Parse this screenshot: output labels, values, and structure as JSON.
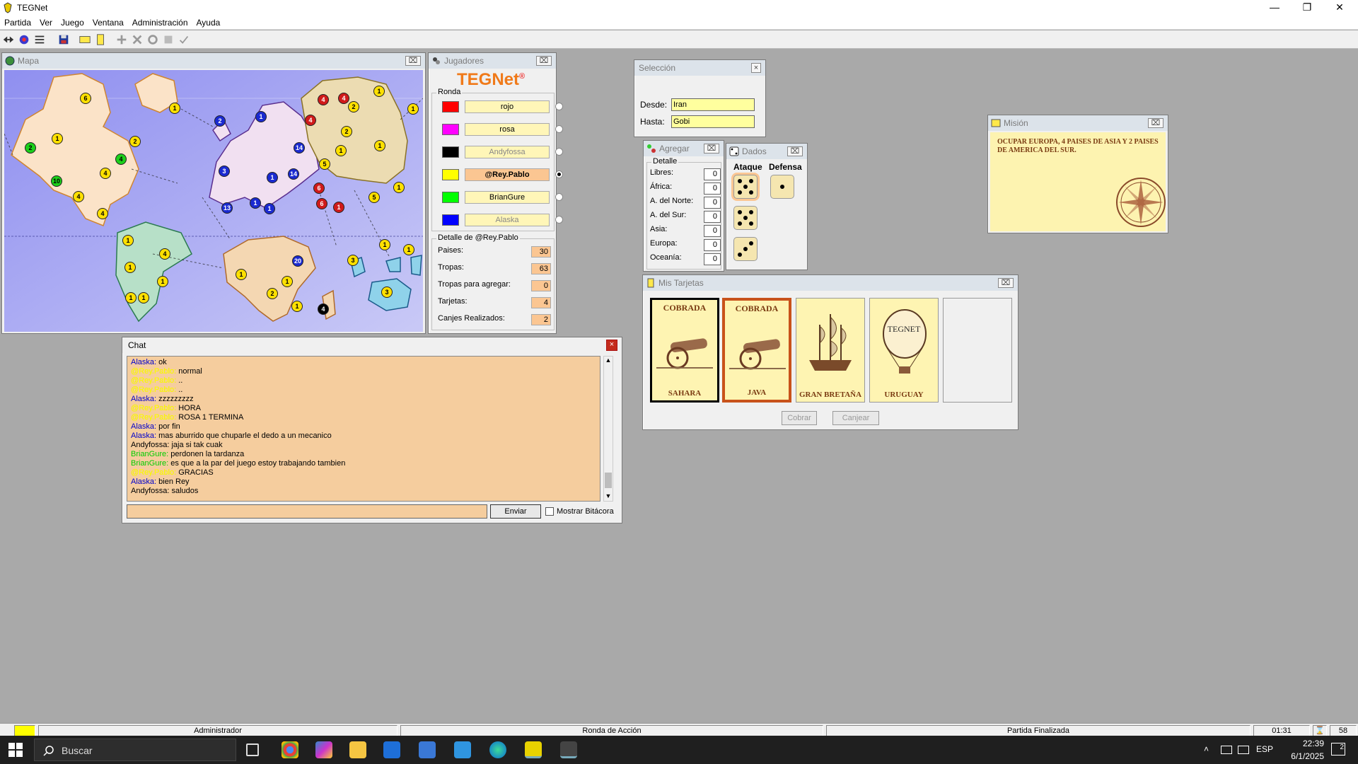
{
  "app": {
    "title": "TEGNet"
  },
  "menu": [
    "Partida",
    "Ver",
    "Juego",
    "Ventana",
    "Administración",
    "Ayuda"
  ],
  "toolbar": {
    "icons": [
      "connect-icon",
      "player-icon",
      "list-icon",
      "save-icon",
      "card-icon",
      "mission-icon",
      "attack-icon",
      "cancel-icon",
      "move-icon",
      "regroup-icon",
      "check-icon"
    ]
  },
  "map_window": {
    "title": "Mapa",
    "armies": [
      {
        "c": "yellow",
        "n": "6"
      },
      {
        "c": "yellow",
        "n": "1"
      },
      {
        "c": "green",
        "n": "2"
      },
      {
        "c": "yellow",
        "n": "1"
      },
      {
        "c": "yellow",
        "n": "2"
      },
      {
        "c": "green",
        "n": "4"
      },
      {
        "c": "green",
        "n": "10"
      },
      {
        "c": "yellow",
        "n": "4"
      },
      {
        "c": "yellow",
        "n": "4"
      },
      {
        "c": "yellow",
        "n": "4"
      },
      {
        "c": "blue",
        "n": "2"
      },
      {
        "c": "blue",
        "n": "1"
      },
      {
        "c": "blue",
        "n": "14"
      },
      {
        "c": "blue",
        "n": "3"
      },
      {
        "c": "blue",
        "n": "1"
      },
      {
        "c": "blue",
        "n": "1"
      },
      {
        "c": "blue",
        "n": "14"
      },
      {
        "c": "blue",
        "n": "13"
      },
      {
        "c": "blue",
        "n": "1"
      },
      {
        "c": "red",
        "n": "4"
      },
      {
        "c": "red",
        "n": "4"
      },
      {
        "c": "red",
        "n": "4"
      },
      {
        "c": "red",
        "n": "6"
      },
      {
        "c": "red",
        "n": "6"
      },
      {
        "c": "red",
        "n": "1"
      },
      {
        "c": "yellow",
        "n": "1"
      },
      {
        "c": "yellow",
        "n": "1"
      },
      {
        "c": "yellow",
        "n": "2"
      },
      {
        "c": "yellow",
        "n": "2"
      },
      {
        "c": "yellow",
        "n": "1"
      },
      {
        "c": "yellow",
        "n": "5"
      },
      {
        "c": "yellow",
        "n": "1"
      },
      {
        "c": "yellow",
        "n": "5"
      },
      {
        "c": "yellow",
        "n": "1"
      },
      {
        "c": "yellow",
        "n": "1"
      },
      {
        "c": "yellow",
        "n": "4"
      },
      {
        "c": "yellow",
        "n": "1"
      },
      {
        "c": "yellow",
        "n": "1"
      },
      {
        "c": "yellow",
        "n": "1"
      },
      {
        "c": "yellow",
        "n": "1"
      },
      {
        "c": "yellow",
        "n": "1"
      },
      {
        "c": "blue",
        "n": "20"
      },
      {
        "c": "yellow",
        "n": "1"
      },
      {
        "c": "yellow",
        "n": "2"
      },
      {
        "c": "yellow",
        "n": "1"
      },
      {
        "c": "black",
        "n": "4"
      },
      {
        "c": "yellow",
        "n": "3"
      },
      {
        "c": "yellow",
        "n": "1"
      },
      {
        "c": "yellow",
        "n": "1"
      },
      {
        "c": "yellow",
        "n": "3"
      }
    ]
  },
  "players_window": {
    "title": "Jugadores",
    "logo": "TEGNet",
    "logo_mark": "®",
    "round_label": "Ronda",
    "players": [
      {
        "name": "rojo",
        "color": "#ff0000",
        "active": false,
        "dim": false
      },
      {
        "name": "rosa",
        "color": "#ff00ff",
        "active": false,
        "dim": false
      },
      {
        "name": "Andyfossa",
        "color": "#000000",
        "active": false,
        "dim": true
      },
      {
        "name": "@Rey.Pablo",
        "color": "#ffff00",
        "active": true,
        "dim": false
      },
      {
        "name": "BrianGure",
        "color": "#00ff00",
        "active": false,
        "dim": false
      },
      {
        "name": "Alaska",
        "color": "#0000ff",
        "active": false,
        "dim": true
      }
    ],
    "detail_label": "Detalle de @Rey.Pablo",
    "details": [
      {
        "label": "Paises:",
        "value": "30"
      },
      {
        "label": "Tropas:",
        "value": "63"
      },
      {
        "label": "Tropas para agregar:",
        "value": "0"
      },
      {
        "label": "Tarjetas:",
        "value": "4"
      },
      {
        "label": "Canjes Realizados:",
        "value": "2"
      }
    ]
  },
  "selection_window": {
    "title": "Selección",
    "from_label": "Desde:",
    "from_value": "Iran",
    "to_label": "Hasta:",
    "to_value": "Gobi"
  },
  "add_window": {
    "title": "Agregar",
    "detail_label": "Detalle",
    "rows": [
      {
        "label": "Libres:",
        "value": "0"
      },
      {
        "label": "África:",
        "value": "0"
      },
      {
        "label": "A. del Norte:",
        "value": "0"
      },
      {
        "label": "A. del Sur:",
        "value": "0"
      },
      {
        "label": "Asia:",
        "value": "0"
      },
      {
        "label": "Europa:",
        "value": "0"
      },
      {
        "label": "Oceanía:",
        "value": "0"
      }
    ]
  },
  "dice_window": {
    "title": "Dados",
    "attack_label": "Ataque",
    "defense_label": "Defensa",
    "attack": [
      5,
      5,
      3
    ],
    "defense": [
      1
    ]
  },
  "mission_window": {
    "title": "Misión",
    "text": "OCUPAR EUROPA, 4 PAISES DE ASIA Y 2 PAISES DE AMERICA DEL SUR."
  },
  "cards_window": {
    "title": "Mis Tarjetas",
    "cards": [
      {
        "top": "COBRADA",
        "country": "SAHARA",
        "symbol": "cannon-icon",
        "selected": "black"
      },
      {
        "top": "COBRADA",
        "country": "JAVA",
        "symbol": "cannon-icon",
        "selected": "orange"
      },
      {
        "top": "",
        "country": "GRAN BRETAÑA",
        "symbol": "ship-icon",
        "selected": "none"
      },
      {
        "top": "",
        "country": "URUGUAY",
        "symbol": "balloon-icon",
        "selected": "none",
        "balloon_text": "TEGNET"
      }
    ],
    "collect_button": "Cobrar",
    "exchange_button": "Canjear"
  },
  "chat_window": {
    "title": "Chat",
    "lines": [
      {
        "name": "Alaska:",
        "color": "#0000cc",
        "text": "ok"
      },
      {
        "name": "@Rey.Pablo:",
        "color": "#ffff00",
        "text": "normal"
      },
      {
        "name": "@Rey.Pablo:",
        "color": "#ffff00",
        "text": ".."
      },
      {
        "name": "@Rey.Pablo:",
        "color": "#ffff00",
        "text": ".."
      },
      {
        "name": "Alaska:",
        "color": "#0000cc",
        "text": "zzzzzzzzz"
      },
      {
        "name": "@Rey.Pablo:",
        "color": "#ffff00",
        "text": "HORA"
      },
      {
        "name": "@Rey.Pablo:",
        "color": "#ffff00",
        "text": "ROSA 1 TERMINA"
      },
      {
        "name": "Alaska:",
        "color": "#0000cc",
        "text": "por fin"
      },
      {
        "name": "Alaska:",
        "color": "#0000cc",
        "text": "mas aburrido que chuparle el dedo a un mecanico"
      },
      {
        "name": "Andyfossa:",
        "color": "#000000",
        "text": "jaja si tak cuak"
      },
      {
        "name": "BrianGure:",
        "color": "#00cc00",
        "text": "perdonen la tardanza"
      },
      {
        "name": "BrianGure:",
        "color": "#00cc00",
        "text": "es que a la par del juego estoy trabajando tambien"
      },
      {
        "name": "@Rey.Pablo:",
        "color": "#ffff00",
        "text": "GRACIAS"
      },
      {
        "name": "Alaska:",
        "color": "#0000cc",
        "text": "bien Rey"
      },
      {
        "name": "Andyfossa:",
        "color": "#000000",
        "text": "saludos"
      }
    ],
    "input_value": "",
    "send_button": "Enviar",
    "log_checkbox_label": "Mostrar Bitácora"
  },
  "status": {
    "user": "Administrador",
    "phase": "Ronda de Acción",
    "game_state": "Partida Finalizada",
    "time": "01:31",
    "count": "58",
    "color": "#ffff00"
  },
  "taskbar": {
    "search_placeholder": "Buscar",
    "lang": "ESP",
    "time": "22:39",
    "date": "6/1/2025",
    "notif": "2"
  }
}
